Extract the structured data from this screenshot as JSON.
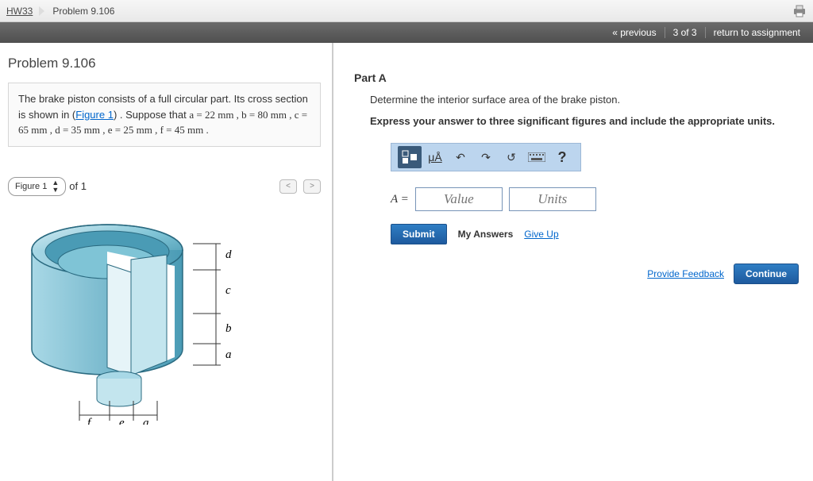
{
  "breadcrumb": {
    "hw": "HW33",
    "problem": "Problem 9.106"
  },
  "nav": {
    "prev": "« previous",
    "pos": "3 of 3",
    "return": "return to assignment"
  },
  "left": {
    "title": "Problem 9.106",
    "desc_pre": "The brake piston consists of a full circular part. Its cross section is shown in (",
    "fig_link": "Figure 1",
    "desc_post": ") . Suppose that ",
    "params": "a = 22  mm  , b = 80  mm , c = 65  mm , d = 35  mm , e = 25  mm , f = 45  mm .",
    "figlabel": "Figure 1",
    "figof": "of 1",
    "dims": {
      "a": "a",
      "b": "b",
      "c": "c",
      "d": "d",
      "e": "e",
      "f": "f"
    }
  },
  "right": {
    "part": "Part A",
    "q": "Determine the interior surface area of the brake piston.",
    "instr": "Express your answer to three significant figures and include the appropriate units.",
    "alabel": "A = ",
    "value_ph": "Value",
    "units_ph": "Units",
    "submit": "Submit",
    "myans": "My Answers",
    "giveup": "Give Up",
    "pfb": "Provide Feedback",
    "cont": "Continue",
    "tool_mu": "μÅ",
    "tool_help": "?"
  }
}
